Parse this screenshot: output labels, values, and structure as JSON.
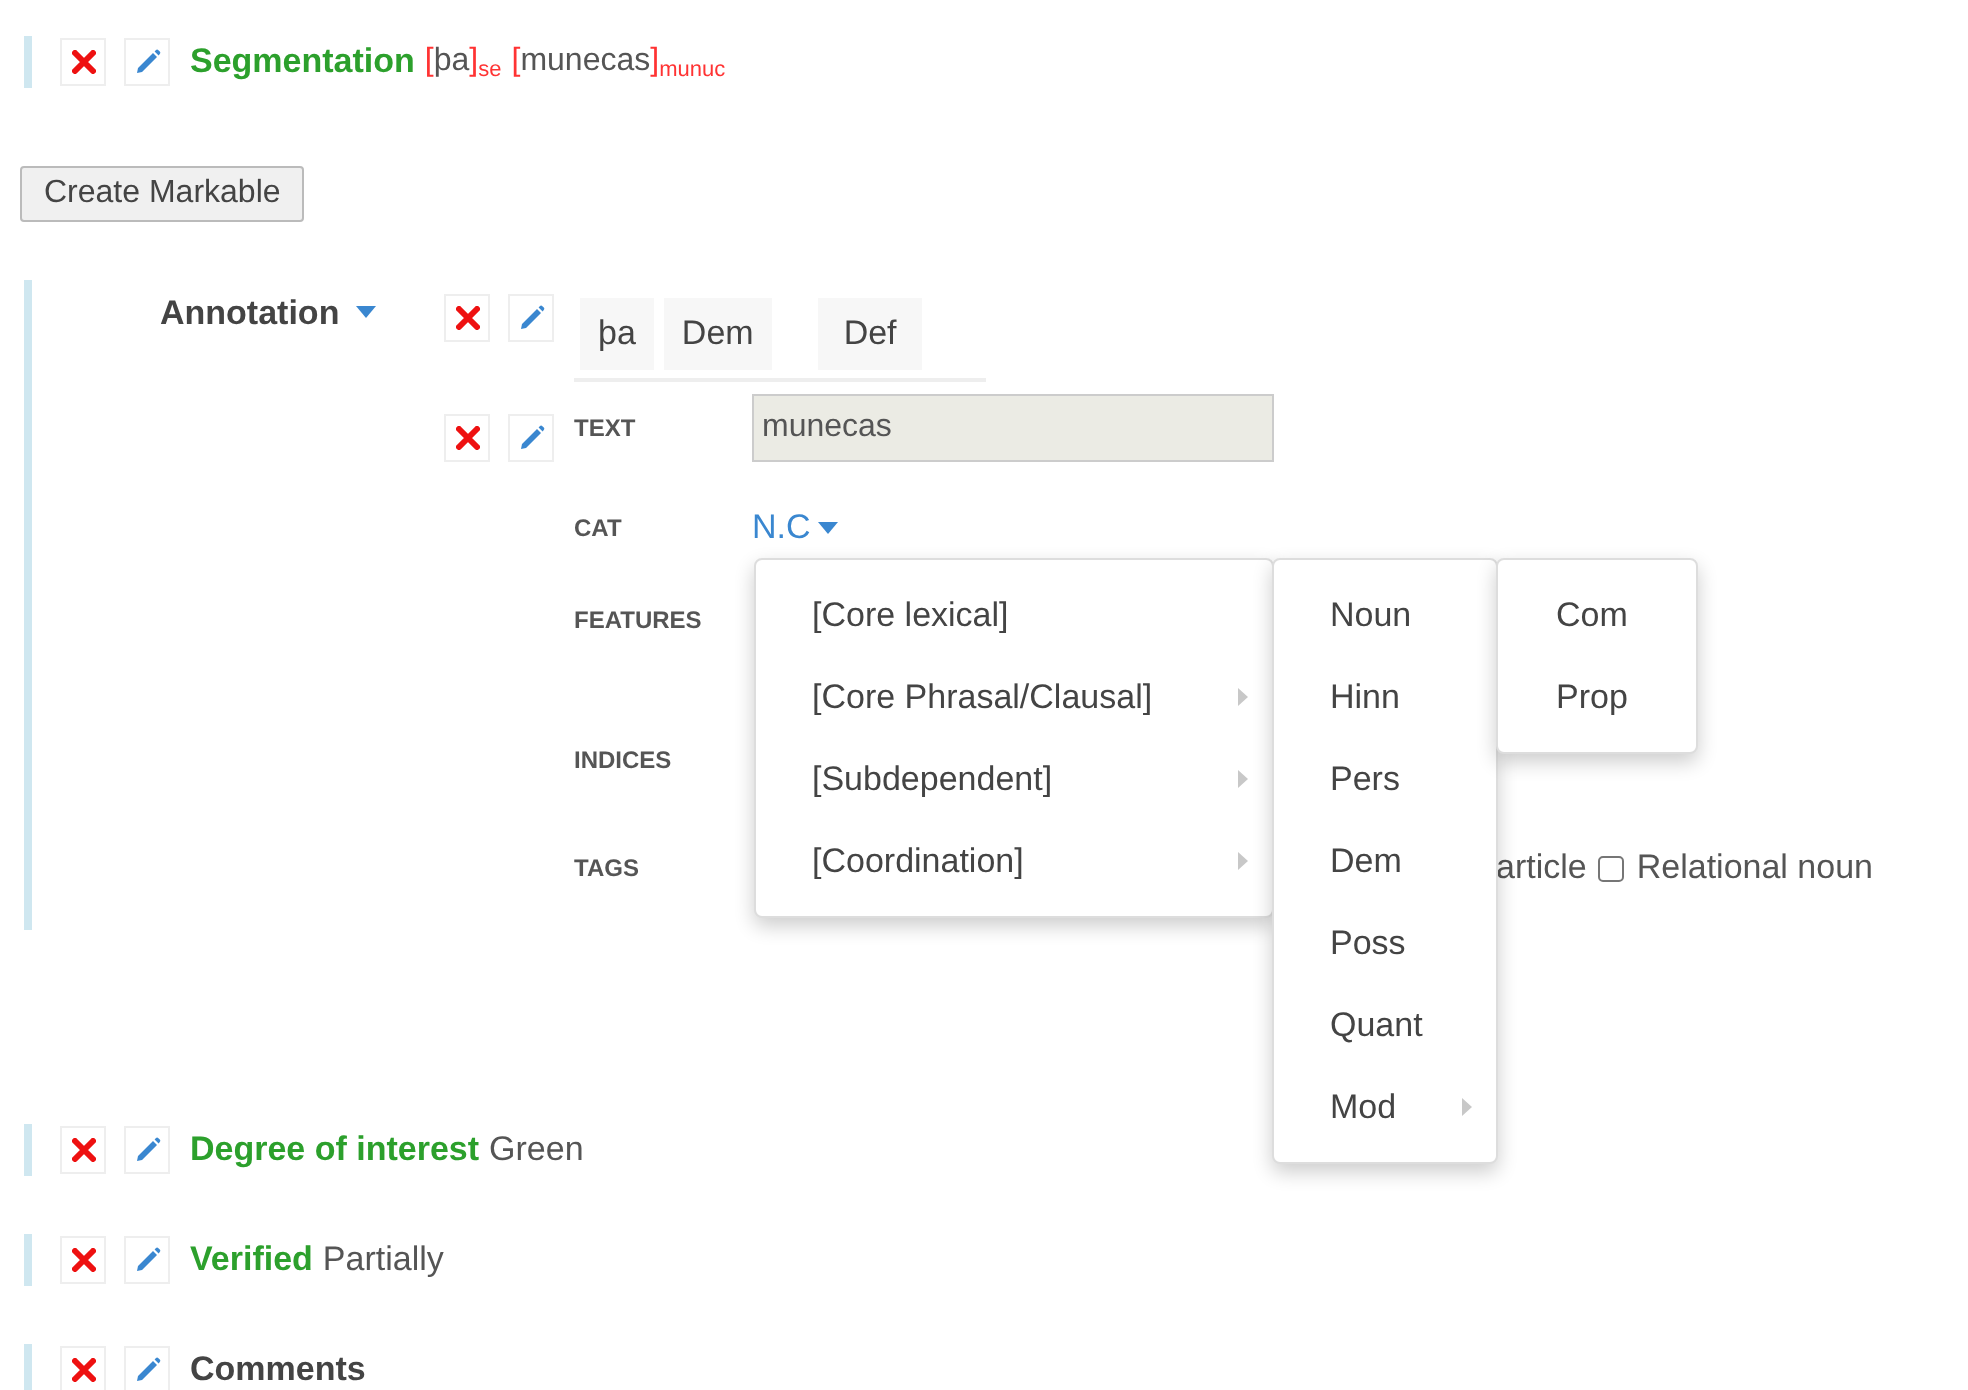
{
  "segmentation": {
    "label": "Segmentation",
    "segments": [
      {
        "open": "[",
        "text": "þa",
        "close": "]",
        "tag": "se"
      },
      {
        "open": "[",
        "text": "munecas",
        "close": "]",
        "tag": "munuc"
      }
    ]
  },
  "create_button": "Create Markable",
  "annotation": {
    "title": "Annotation",
    "tokens": [
      "þa",
      "Dem",
      "Def"
    ],
    "fields": [
      {
        "kind": "input",
        "label": "TEXT",
        "value": "munecas"
      },
      {
        "kind": "select",
        "label": "CAT",
        "value": "N.C"
      },
      {
        "kind": "empty",
        "label": "FEATURES"
      },
      {
        "kind": "empty",
        "label": "INDICES"
      },
      {
        "kind": "checkboxes",
        "label": "TAGS",
        "options": [
          {
            "label": "article"
          },
          {
            "label": "Relational noun",
            "checked": false
          }
        ]
      }
    ]
  },
  "cat_menu": {
    "items": [
      {
        "label": "[Core lexical]",
        "has_submenu": false,
        "expanded": true,
        "children": [
          {
            "label": "Noun",
            "has_submenu": false,
            "expanded": true,
            "children": [
              {
                "label": "Com",
                "has_submenu": false
              },
              {
                "label": "Prop",
                "has_submenu": false
              }
            ]
          },
          {
            "label": "Hinn",
            "has_submenu": false
          },
          {
            "label": "Pers",
            "has_submenu": false
          },
          {
            "label": "Dem",
            "has_submenu": false
          },
          {
            "label": "Poss",
            "has_submenu": false
          },
          {
            "label": "Quant",
            "has_submenu": false
          },
          {
            "label": "Mod",
            "has_submenu": true
          }
        ]
      },
      {
        "label": "[Core Phrasal/Clausal]",
        "has_submenu": true
      },
      {
        "label": "[Subdependent]",
        "has_submenu": true
      },
      {
        "label": "[Coordination]",
        "has_submenu": true
      }
    ]
  },
  "properties": [
    {
      "label": "Degree of interest",
      "value": "Green",
      "filled": true
    },
    {
      "label": "Verified",
      "value": "Partially",
      "filled": true
    },
    {
      "label": "Comments",
      "filled": false
    }
  ]
}
